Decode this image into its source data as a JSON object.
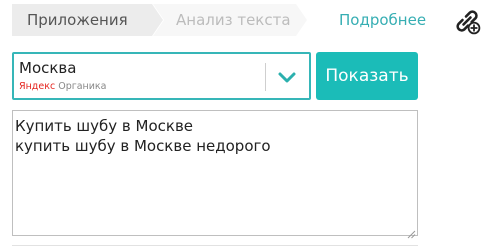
{
  "nav": {
    "crumbs": [
      {
        "label": "Приложения"
      },
      {
        "label": "Анализ текста"
      }
    ],
    "more_label": "Подробнее",
    "link_icon": "link-add-icon"
  },
  "region": {
    "value": "Москва",
    "source_brand": "Яндекс",
    "source_type": "Органика",
    "dropdown_icon": "chevron-down-icon"
  },
  "show_button": {
    "label": "Показать"
  },
  "query": {
    "lines": [
      "Купить шубу в Москве",
      "купить шубу в Москве недорого"
    ]
  },
  "colors": {
    "accent": "#1bbcb8",
    "border_accent": "#36b6b8",
    "link": "#36aeb3",
    "yandex": "#e52620"
  }
}
